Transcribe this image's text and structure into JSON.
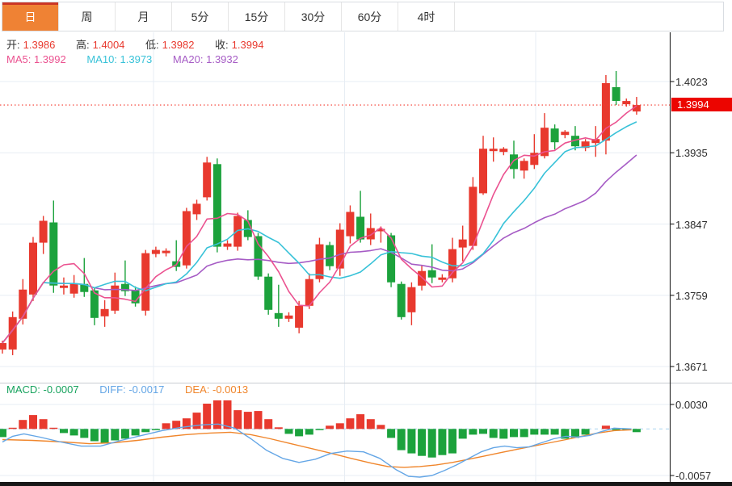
{
  "tabs": {
    "items": [
      "日",
      "周",
      "月",
      "5分",
      "15分",
      "30分",
      "60分",
      "4时"
    ],
    "active_index": 0
  },
  "legend_ohlc": {
    "open_label": "开:",
    "open_value": "1.3986",
    "high_label": "高:",
    "high_value": "1.4004",
    "low_label": "低:",
    "low_value": "1.3982",
    "close_label": "收:",
    "close_value": "1.3994"
  },
  "legend_ma": {
    "ma5": "MA5: 1.3992",
    "ma10": "MA10: 1.3973",
    "ma20": "MA20: 1.3932"
  },
  "legend_macd": {
    "macd": "MACD: -0.0007",
    "diff": "DIFF: -0.0017",
    "dea": "DEA: -0.0013"
  },
  "price_axis": {
    "tick_labels": [
      "1.4023",
      "1.3935",
      "1.3847",
      "1.3759",
      "1.3671"
    ],
    "current_price_label": "1.3994"
  },
  "macd_axis": {
    "tick_labels": [
      "0.0030",
      "-0.0057"
    ]
  },
  "colors": {
    "up": "#e8392e",
    "down": "#1ca23c",
    "ma5": "#eb5290",
    "ma10": "#38c2d8",
    "ma20": "#a65cc5",
    "diff": "#64a6e6",
    "dea": "#f0862c",
    "macd_text": "#18a35e",
    "value_red": "#e8392e",
    "grid": "#e7edf4",
    "axis_line": "#333333",
    "separator": "#c9cdd3",
    "zero_dash": "#b8dcf2",
    "dotted_price_line": "#f5392e",
    "tab_orange": "#ef8234",
    "tab_top_strip": "#cb3726",
    "price_tag_bg": "#ec0500"
  },
  "chart_data": {
    "type": "candlestick",
    "period_shown": "日",
    "panels": [
      "price",
      "macd"
    ],
    "price_axis": {
      "ticks": [
        1.4023,
        1.3935,
        1.3847,
        1.3759,
        1.3671
      ],
      "current_price": 1.3994,
      "visible_high": 1.4036,
      "visible_low": 1.3671
    },
    "last_bar": {
      "open": 1.3986,
      "high": 1.4004,
      "low": 1.3982,
      "close": 1.3994,
      "ma5": 1.3992,
      "ma10": 1.3973,
      "ma20": 1.3932,
      "macd": -0.0007,
      "diff": -0.0017,
      "dea": -0.0013
    },
    "candles_ohlc": [
      [
        1.3692,
        1.3703,
        1.3687,
        1.37
      ],
      [
        1.3692,
        1.3739,
        1.3685,
        1.3732
      ],
      [
        1.373,
        1.3779,
        1.3723,
        1.3766
      ],
      [
        1.376,
        1.3831,
        1.3752,
        1.3824
      ],
      [
        1.3824,
        1.3857,
        1.381,
        1.3851
      ],
      [
        1.3849,
        1.3876,
        1.3762,
        1.3771
      ],
      [
        1.3768,
        1.3781,
        1.376,
        1.3771
      ],
      [
        1.3761,
        1.3784,
        1.3756,
        1.3773
      ],
      [
        1.3773,
        1.3805,
        1.3757,
        1.3763
      ],
      [
        1.3765,
        1.3768,
        1.3722,
        1.3731
      ],
      [
        1.3733,
        1.3753,
        1.372,
        1.3742
      ],
      [
        1.374,
        1.3787,
        1.3736,
        1.3771
      ],
      [
        1.3773,
        1.3802,
        1.3758,
        1.3764
      ],
      [
        1.3765,
        1.377,
        1.3745,
        1.3749
      ],
      [
        1.374,
        1.3815,
        1.3734,
        1.3811
      ],
      [
        1.381,
        1.3819,
        1.3806,
        1.3815
      ],
      [
        1.3811,
        1.3817,
        1.3807,
        1.3814
      ],
      [
        1.3801,
        1.3827,
        1.3789,
        1.3794
      ],
      [
        1.3796,
        1.3867,
        1.3792,
        1.3863
      ],
      [
        1.3859,
        1.3877,
        1.3852,
        1.3872
      ],
      [
        1.388,
        1.393,
        1.3876,
        1.3923
      ],
      [
        1.3921,
        1.3928,
        1.3812,
        1.3819
      ],
      [
        1.3819,
        1.3827,
        1.3815,
        1.3823
      ],
      [
        1.3819,
        1.3861,
        1.3814,
        1.3857
      ],
      [
        1.3852,
        1.3864,
        1.3827,
        1.3831
      ],
      [
        1.3832,
        1.3836,
        1.3778,
        1.3782
      ],
      [
        1.3782,
        1.3786,
        1.3735,
        1.3741
      ],
      [
        1.3737,
        1.3772,
        1.372,
        1.373
      ],
      [
        1.373,
        1.3738,
        1.3726,
        1.3734
      ],
      [
        1.3719,
        1.3752,
        1.3712,
        1.3746
      ],
      [
        1.3746,
        1.3786,
        1.3742,
        1.3779
      ],
      [
        1.3779,
        1.383,
        1.3775,
        1.3822
      ],
      [
        1.3821,
        1.3825,
        1.379,
        1.3795
      ],
      [
        1.3792,
        1.3848,
        1.3783,
        1.384
      ],
      [
        1.3832,
        1.387,
        1.3823,
        1.3862
      ],
      [
        1.3856,
        1.3888,
        1.3824,
        1.3828
      ],
      [
        1.3828,
        1.386,
        1.3821,
        1.3842
      ],
      [
        1.3838,
        1.3844,
        1.3824,
        1.3841
      ],
      [
        1.3833,
        1.3836,
        1.3769,
        1.3775
      ],
      [
        1.3773,
        1.3776,
        1.3729,
        1.3732
      ],
      [
        1.3738,
        1.3775,
        1.3722,
        1.3769
      ],
      [
        1.3771,
        1.3796,
        1.3765,
        1.3789
      ],
      [
        1.379,
        1.3822,
        1.3774,
        1.3781
      ],
      [
        1.3778,
        1.3785,
        1.3775,
        1.3781
      ],
      [
        1.378,
        1.383,
        1.3775,
        1.3816
      ],
      [
        1.3818,
        1.3845,
        1.3801,
        1.3828
      ],
      [
        1.382,
        1.3905,
        1.3815,
        1.3893
      ],
      [
        1.3885,
        1.3956,
        1.3883,
        1.394
      ],
      [
        1.3937,
        1.3954,
        1.3924,
        1.394
      ],
      [
        1.3936,
        1.3942,
        1.3932,
        1.394
      ],
      [
        1.3933,
        1.395,
        1.3903,
        1.3915
      ],
      [
        1.3913,
        1.3928,
        1.3903,
        1.3925
      ],
      [
        1.392,
        1.3958,
        1.3915,
        1.3935
      ],
      [
        1.3931,
        1.3984,
        1.3928,
        1.3966
      ],
      [
        1.3965,
        1.397,
        1.3939,
        1.3948
      ],
      [
        1.3957,
        1.3963,
        1.3953,
        1.3961
      ],
      [
        1.3956,
        1.3968,
        1.3938,
        1.3943
      ],
      [
        1.3941,
        1.3952,
        1.3937,
        1.3949
      ],
      [
        1.3947,
        1.3968,
        1.393,
        1.3952
      ],
      [
        1.395,
        1.4031,
        1.3933,
        1.4021
      ],
      [
        1.4016,
        1.4036,
        1.3994,
        1.3999
      ],
      [
        1.3995,
        1.4002,
        1.3992,
        1.3999
      ],
      [
        1.3986,
        1.4004,
        1.3982,
        1.3994
      ]
    ],
    "moving_average_periods": [
      5,
      10,
      20
    ],
    "macd": {
      "axis_ticks": [
        0.003,
        -0.0057
      ],
      "histogram": [
        -0.001,
        0.0001,
        0.0011,
        0.0017,
        0.0012,
        0.0001,
        -0.0005,
        -0.0008,
        -0.0011,
        -0.0015,
        -0.0017,
        -0.0014,
        -0.0012,
        -0.0008,
        -0.0004,
        -0.0001,
        0.0007,
        0.001,
        0.0013,
        0.002,
        0.0031,
        0.0035,
        0.0035,
        0.0023,
        0.0021,
        0.0022,
        0.0012,
        0.0002,
        -0.0006,
        -0.0009,
        -0.0007,
        -0.0001,
        0.0004,
        0.0007,
        0.0013,
        0.0018,
        0.0012,
        0.0005,
        -0.0011,
        -0.0026,
        -0.003,
        -0.0033,
        -0.0035,
        -0.0032,
        -0.003,
        -0.0012,
        -0.0007,
        -0.0006,
        -0.0011,
        -0.0012,
        -0.001,
        -0.001,
        -0.0007,
        -0.0007,
        -0.0007,
        -0.0012,
        -0.0011,
        -0.0007,
        0.0,
        0.0004,
        -0.0001,
        -0.0001,
        -0.0004
      ],
      "diff_points": [
        [
          0,
          -0.0016
        ],
        [
          1,
          -0.0009
        ],
        [
          2.1,
          -0.0006
        ],
        [
          3.7,
          -0.001
        ],
        [
          5.7,
          -0.0016
        ],
        [
          7.7,
          -0.0021
        ],
        [
          9.6,
          -0.0021
        ],
        [
          11.6,
          -0.0014
        ],
        [
          13.6,
          -0.0008
        ],
        [
          15.6,
          -0.0002
        ],
        [
          17.5,
          0.0002
        ],
        [
          19.5,
          0.0005
        ],
        [
          21.1,
          0.0006
        ],
        [
          22.7,
          0.0001
        ],
        [
          24.3,
          -0.0012
        ],
        [
          25.8,
          -0.0026
        ],
        [
          27.4,
          -0.0036
        ],
        [
          29,
          -0.0041
        ],
        [
          30.6,
          -0.0037
        ],
        [
          32.1,
          -0.003
        ],
        [
          33.7,
          -0.0027
        ],
        [
          35.3,
          -0.0028
        ],
        [
          36.9,
          -0.0036
        ],
        [
          38.5,
          -0.005
        ],
        [
          39.7,
          -0.0058
        ],
        [
          40.8,
          -0.0059
        ],
        [
          42,
          -0.0057
        ],
        [
          43.2,
          -0.0051
        ],
        [
          44.4,
          -0.0044
        ],
        [
          45.6,
          -0.0036
        ],
        [
          46.8,
          -0.0028
        ],
        [
          48,
          -0.0023
        ],
        [
          49.1,
          -0.0021
        ],
        [
          50.3,
          -0.0023
        ],
        [
          51.5,
          -0.0022
        ],
        [
          52.7,
          -0.0017
        ],
        [
          53.9,
          -0.0012
        ],
        [
          55.1,
          -0.0009
        ],
        [
          56.2,
          -0.001
        ],
        [
          57.4,
          -0.0008
        ],
        [
          58.6,
          -0.0003
        ],
        [
          59.8,
          0.0001
        ],
        [
          61.5,
          0.0
        ]
      ],
      "dea_points": [
        [
          0,
          -0.0013
        ],
        [
          2.9,
          -0.0014
        ],
        [
          6.1,
          -0.0016
        ],
        [
          8.5,
          -0.0018
        ],
        [
          10.8,
          -0.0017
        ],
        [
          13.2,
          -0.0014
        ],
        [
          15.6,
          -0.001
        ],
        [
          17.9,
          -0.0007
        ],
        [
          20.3,
          -0.0005
        ],
        [
          22.3,
          -0.0004
        ],
        [
          24.3,
          -0.0007
        ],
        [
          26.2,
          -0.0012
        ],
        [
          28.2,
          -0.0018
        ],
        [
          30.2,
          -0.0024
        ],
        [
          32.2,
          -0.003
        ],
        [
          34.1,
          -0.0036
        ],
        [
          36.1,
          -0.0042
        ],
        [
          37.7,
          -0.0046
        ],
        [
          39.3,
          -0.0047
        ],
        [
          40.8,
          -0.0046
        ],
        [
          42.4,
          -0.0044
        ],
        [
          44,
          -0.0041
        ],
        [
          45.6,
          -0.0037
        ],
        [
          47.2,
          -0.0033
        ],
        [
          48.7,
          -0.0029
        ],
        [
          50.3,
          -0.0025
        ],
        [
          51.9,
          -0.0021
        ],
        [
          53.5,
          -0.0017
        ],
        [
          55.1,
          -0.0013
        ],
        [
          56.6,
          -0.0009
        ],
        [
          58.2,
          -0.0005
        ],
        [
          59.8,
          -0.0002
        ],
        [
          61.5,
          -0.0001
        ]
      ]
    }
  }
}
